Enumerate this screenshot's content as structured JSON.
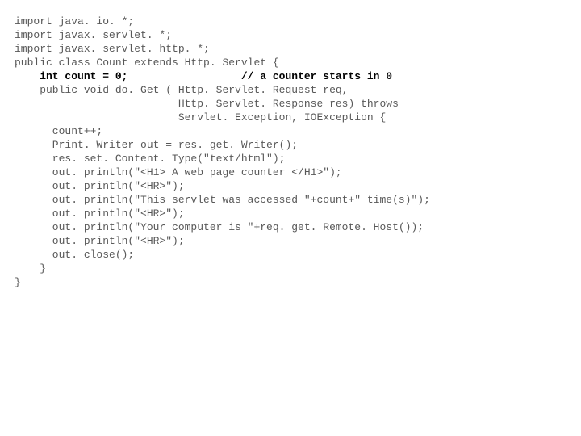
{
  "code": {
    "l01": "import java. io. *;",
    "l02": "import javax. servlet. *;",
    "l03": "import javax. servlet. http. *;",
    "l04": "",
    "l05": "public class Count extends Http. Servlet {",
    "l06": "",
    "l07a": "    int count = 0;",
    "l07b": "                  // a counter starts in 0",
    "l08": "",
    "l09": "    public void do. Get ( Http. Servlet. Request req,",
    "l10": "                          Http. Servlet. Response res) throws",
    "l11": "                          Servlet. Exception, IOException {",
    "l12": "",
    "l13": "      count++;",
    "l14": "",
    "l15": "      Print. Writer out = res. get. Writer();",
    "l16": "      res. set. Content. Type(\"text/html\");",
    "l17": "",
    "l18": "      out. println(\"<H1> A web page counter </H1>\");",
    "l19": "      out. println(\"<HR>\");",
    "l20": "      out. println(\"This servlet was accessed \"+count+\" time(s)\");",
    "l21": "      out. println(\"<HR>\");",
    "l22": "      out. println(\"Your computer is \"+req. get. Remote. Host());",
    "l23": "      out. println(\"<HR>\");",
    "l24": "      out. close();",
    "l25": "    }",
    "l26": "}"
  }
}
